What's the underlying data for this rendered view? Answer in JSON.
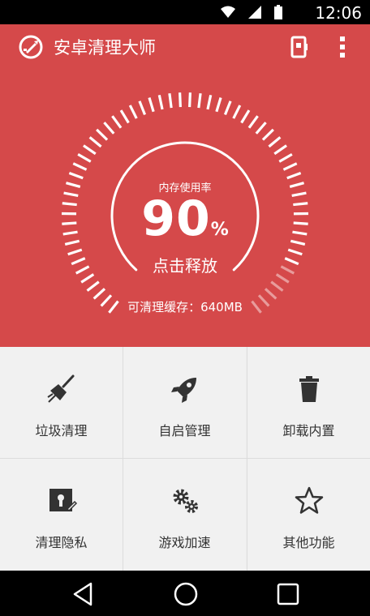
{
  "status_bar": {
    "time": "12:06"
  },
  "app": {
    "title": "安卓清理大师"
  },
  "gauge": {
    "label": "内存使用率",
    "usage_value": "90",
    "usage_unit": "%",
    "usage_fraction": 0.9,
    "action": "点击释放",
    "cache_text": "可清理缓存：640MB"
  },
  "tiles": [
    {
      "label": "垃圾清理",
      "icon": "broom-icon"
    },
    {
      "label": "自启管理",
      "icon": "rocket-icon"
    },
    {
      "label": "卸载内置",
      "icon": "trash-icon"
    },
    {
      "label": "清理隐私",
      "icon": "private-file-icon"
    },
    {
      "label": "游戏加速",
      "icon": "gears-icon"
    },
    {
      "label": "其他功能",
      "icon": "star-icon"
    }
  ],
  "colors": {
    "primary": "#d5494a",
    "grid_bg": "#f1f1f1",
    "text_dark": "#333333"
  }
}
